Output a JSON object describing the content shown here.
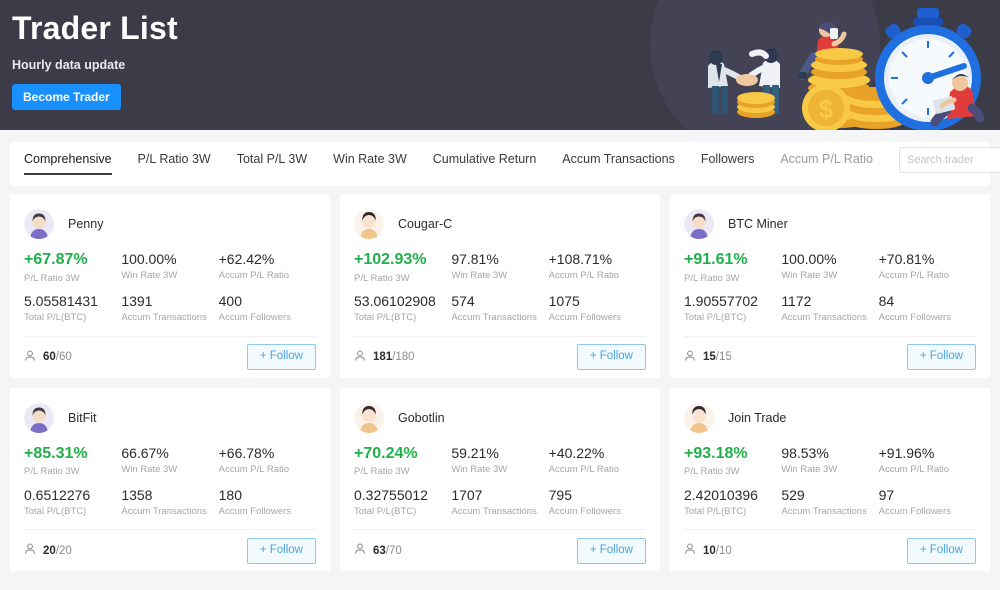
{
  "hero": {
    "title": "Trader List",
    "subtitle": "Hourly data update",
    "cta_label": "Become Trader",
    "accent_color": "#1890ff",
    "background_color": "#3c3c48",
    "illustration": "trading-handshake-coins-stopwatch-illustration"
  },
  "tabs": [
    {
      "label": "Comprehensive",
      "active": true
    },
    {
      "label": "P/L Ratio 3W",
      "active": false
    },
    {
      "label": "Total P/L 3W",
      "active": false
    },
    {
      "label": "Win Rate 3W",
      "active": false
    },
    {
      "label": "Cumulative Return",
      "active": false
    },
    {
      "label": "Accum Transactions",
      "active": false
    },
    {
      "label": "Followers",
      "active": false
    },
    {
      "label": "Accum P/L Ratio",
      "active": false
    }
  ],
  "search": {
    "placeholder": "Search trader",
    "value": "",
    "icon": "search-icon"
  },
  "labels": {
    "pl_ratio": "P/L Ratio 3W",
    "win_rate": "Win Rate 3W",
    "accum_pl_ratio": "Accum P/L Ratio",
    "total_pl": "Total P/L(BTC)",
    "accum_transactions": "Accum Transactions",
    "accum_followers": "Accum Followers",
    "follow_button": "+ Follow",
    "positive_color": "#20b04b"
  },
  "traders": [
    {
      "name": "Penny",
      "avatar": "purple",
      "pl_ratio": "+67.87%",
      "win_rate": "100.00%",
      "accum_pl_ratio": "+62.42%",
      "total_pl": "5.05581431",
      "accum_transactions": "1391",
      "accum_followers": "400",
      "followers_current": "60",
      "followers_max": "/60"
    },
    {
      "name": "Cougar-C",
      "avatar": "cream",
      "pl_ratio": "+102.93%",
      "win_rate": "97.81%",
      "accum_pl_ratio": "+108.71%",
      "total_pl": "53.06102908",
      "accum_transactions": "574",
      "accum_followers": "1075",
      "followers_current": "181",
      "followers_max": "/180"
    },
    {
      "name": "BTC Miner",
      "avatar": "purple",
      "pl_ratio": "+91.61%",
      "win_rate": "100.00%",
      "accum_pl_ratio": "+70.81%",
      "total_pl": "1.90557702",
      "accum_transactions": "1172",
      "accum_followers": "84",
      "followers_current": "15",
      "followers_max": "/15"
    },
    {
      "name": "BitFit",
      "avatar": "purple",
      "pl_ratio": "+85.31%",
      "win_rate": "66.67%",
      "accum_pl_ratio": "+66.78%",
      "total_pl": "0.6512276",
      "accum_transactions": "1358",
      "accum_followers": "180",
      "followers_current": "20",
      "followers_max": "/20"
    },
    {
      "name": "Gobotlin",
      "avatar": "cream",
      "pl_ratio": "+70.24%",
      "win_rate": "59.21%",
      "accum_pl_ratio": "+40.22%",
      "total_pl": "0.32755012",
      "accum_transactions": "1707",
      "accum_followers": "795",
      "followers_current": "63",
      "followers_max": "/70"
    },
    {
      "name": "Join Trade",
      "avatar": "cream",
      "pl_ratio": "+93.18%",
      "win_rate": "98.53%",
      "accum_pl_ratio": "+91.96%",
      "total_pl": "2.42010396",
      "accum_transactions": "529",
      "accum_followers": "97",
      "followers_current": "10",
      "followers_max": "/10"
    }
  ]
}
